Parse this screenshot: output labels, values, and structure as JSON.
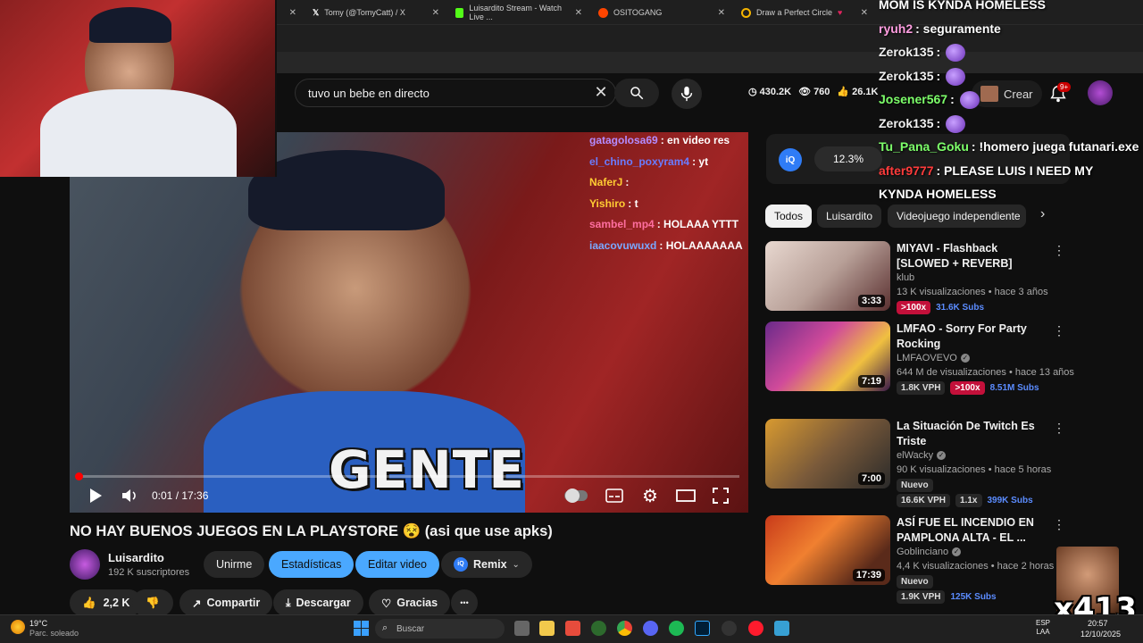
{
  "browser": {
    "tabs": [
      {
        "label": "Tomy (@TomyCatt) / X"
      },
      {
        "label": "Luisardito Stream - Watch Live ..."
      },
      {
        "label": "OSITOGANG"
      },
      {
        "label": "Draw a Perfect Circle"
      }
    ]
  },
  "search": {
    "query": "tuvo un bebe en directo"
  },
  "stats": {
    "views": "430.2K",
    "watching": "760",
    "likes": "26.1K"
  },
  "header": {
    "create_label": "Crear",
    "notif_badge": "9+"
  },
  "video": {
    "subtitle": "GENTE",
    "time": "0:01 / 17:36",
    "progress": 0.001,
    "chat": [
      {
        "user": "gatagolosa69",
        "text": ": en video res",
        "color": "#b48cff"
      },
      {
        "user": "el_chino_poxyram4",
        "text": ": yt",
        "color": "#6a7cff"
      },
      {
        "user": "NaferJ",
        "text": ":",
        "color": "#ffcc33"
      },
      {
        "user": "Yishiro",
        "text": ": t",
        "color": "#ffcc33"
      },
      {
        "user": "sambel_mp4",
        "text": ": HOLAAA YTTT",
        "color": "#ff6e9f"
      },
      {
        "user": "iaacovuwuxd",
        "text": ": HOLAAAAAAA",
        "color": "#7aa8ff"
      }
    ]
  },
  "stream_chat": [
    {
      "user": "MOM IS KYNDA HOMELESS",
      "text": "",
      "color": "#ffffff"
    },
    {
      "user": "ryuh2",
      "text": ": seguramente",
      "color": "#ff9de0"
    },
    {
      "user": "Zerok135",
      "text": ":",
      "color": "#f1f1f1"
    },
    {
      "user": "Zerok135",
      "text": ":",
      "color": "#f1f1f1"
    },
    {
      "user": "Josener567",
      "text": ":",
      "color": "#7dff6a"
    },
    {
      "user": "Zerok135",
      "text": ":",
      "color": "#f1f1f1"
    },
    {
      "user": "Tu_Pana_Goku",
      "text": ": !homero juega futanari.exe",
      "color": "#7dff6a"
    },
    {
      "user": "after9777",
      "text": ": PLEASE LUIS I NEED MY",
      "color": "#ff3b3b"
    },
    {
      "user": "KYNDA HOMELESS",
      "text": "",
      "color": "#ffffff"
    }
  ],
  "iq": {
    "logo": "iQ",
    "percent": "12.3%"
  },
  "chips": [
    "Todos",
    "Luisardito",
    "Videojuego independiente"
  ],
  "recommended": [
    {
      "title": "MIYAVI - Flashback [SLOWED + REVERB]",
      "channel": "klub",
      "meta": "13 K visualizaciones • hace 3 años",
      "duration": "3:33",
      "tags": [
        {
          "t": ">100x",
          "k": "red"
        },
        {
          "t": "31.6K Subs",
          "k": "blue"
        }
      ],
      "verified": false
    },
    {
      "title": "LMFAO - Sorry For Party Rocking",
      "channel": "LMFAOVEVO",
      "meta": "644 M de visualizaciones • hace 13 años",
      "duration": "7:19",
      "tags": [
        {
          "t": "1.8K VPH",
          "k": "gray"
        },
        {
          "t": ">100x",
          "k": "red"
        },
        {
          "t": "8.51M Subs",
          "k": "blue"
        }
      ],
      "verified": true
    },
    {
      "title": "La Situación De Twitch Es Triste",
      "channel": "elWacky",
      "meta": "90 K visualizaciones • hace 5 horas",
      "duration": "7:00",
      "badge": "Nuevo",
      "tags": [
        {
          "t": "16.6K VPH",
          "k": "gray"
        },
        {
          "t": "1.1x",
          "k": "gray"
        },
        {
          "t": "399K Subs",
          "k": "blue"
        }
      ],
      "verified": true
    },
    {
      "title": "ASÍ FUE EL INCENDIO EN PAMPLONA ALTA - EL ...",
      "channel": "Goblinciano",
      "meta": "4,4 K visualizaciones • hace 2 horas",
      "duration": "17:39",
      "badge": "Nuevo",
      "tags": [
        {
          "t": "1.9K VPH",
          "k": "gray"
        },
        {
          "t": "125K Subs",
          "k": "blue"
        }
      ],
      "verified": true
    }
  ],
  "below": {
    "title": "NO HAY BUENOS JUEGOS EN LA PLAYSTORE 😵 (asi que use apks)",
    "channel": "Luisardito",
    "subs": "192 K suscriptores",
    "unsubscribe": "Unirme",
    "stats_btn": "Estadísticas",
    "edit_btn": "Editar video",
    "remix": "Remix",
    "likes": "2,2 K",
    "share": "Compartir",
    "download": "Descargar",
    "thanks": "Gracias",
    "more": "•••"
  },
  "taskbar": {
    "temp": "19°C",
    "weather": "Parc. soleado",
    "search": "Buscar",
    "lang1": "ESP",
    "lang2": "LAA",
    "time": "20:57",
    "date": "12/10/2025"
  },
  "overlay": {
    "counter": "x413"
  }
}
